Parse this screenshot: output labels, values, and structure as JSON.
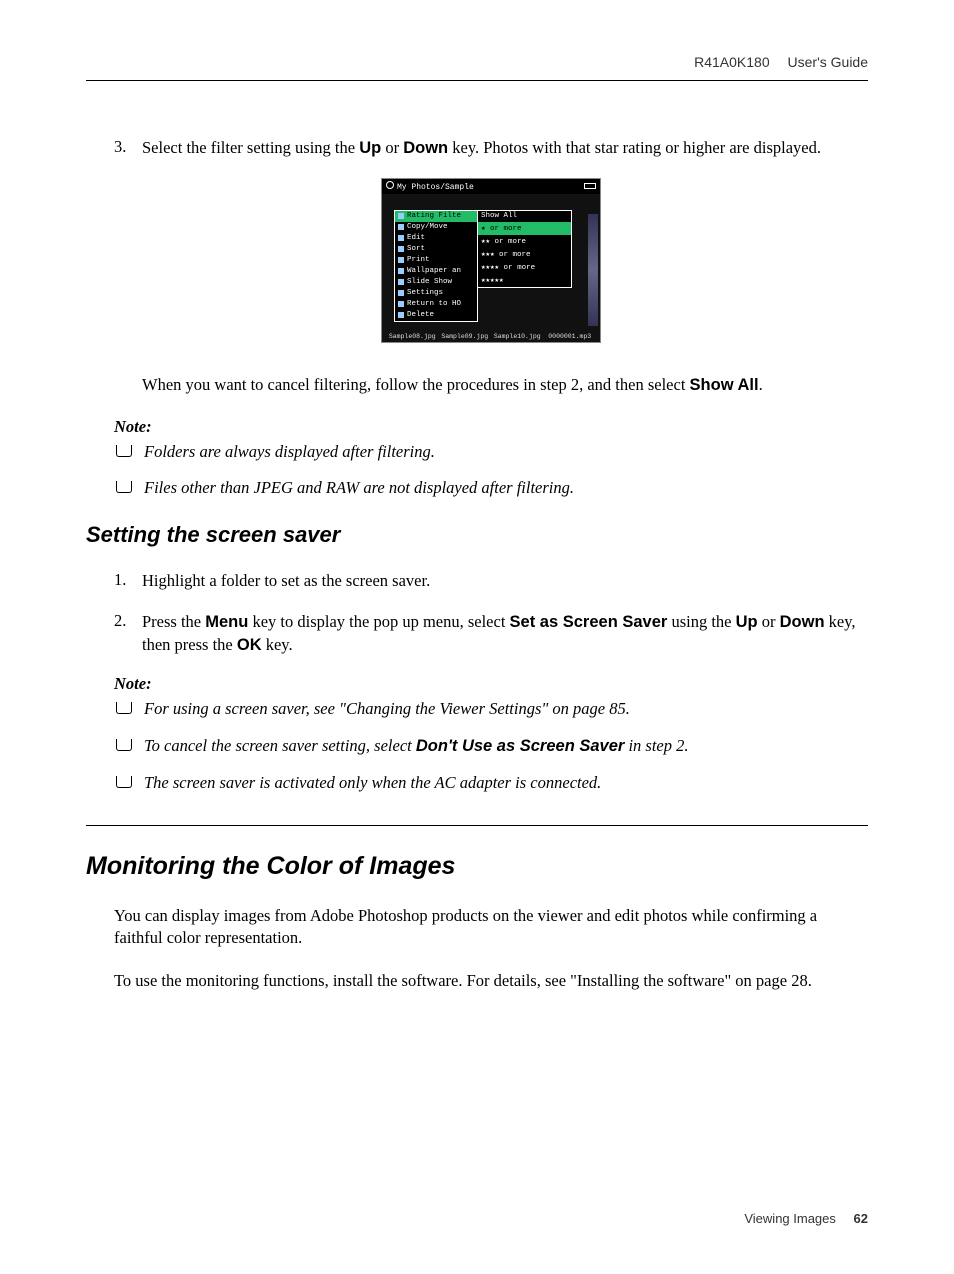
{
  "header": {
    "model": "R41A0K180",
    "doc": "User's Guide"
  },
  "step3": {
    "num": "3.",
    "text_pre": "Select the filter setting using the ",
    "key_up": "Up",
    "text_mid1": " or ",
    "key_down": "Down",
    "text_post": " key. Photos with that star rating or higher are displayed."
  },
  "screenshot": {
    "title": "My Photos/Sample",
    "left_menu": [
      "Rating Filte",
      "Copy/Move",
      "Edit",
      "Sort",
      "Print",
      "Wallpaper an",
      "Slide Show",
      "Settings",
      "Return to HO",
      "Delete"
    ],
    "left_highlight_index": 0,
    "right_menu": [
      "Show All",
      "★ or more",
      "★★ or more",
      "★★★ or more",
      "★★★★ or more",
      "★★★★★"
    ],
    "right_highlight_index": 1,
    "thumbnails": [
      "Sample08.jpg",
      "Sample09.jpg",
      "Sample10.jpg",
      "0000001.mp3"
    ]
  },
  "cancel_para": {
    "pre": "When you want to cancel filtering, follow the procedures in step 2, and then select ",
    "bold": "Show All",
    "post": "."
  },
  "note1": {
    "heading": "Note:",
    "items": [
      "Folders are always displayed after filtering.",
      "Files other than JPEG and RAW are not displayed after filtering."
    ]
  },
  "h2_screensaver": "Setting the screen saver",
  "ss_step1": {
    "num": "1.",
    "text": "Highlight a folder to set as the screen saver."
  },
  "ss_step2": {
    "num": "2.",
    "p1": "Press the ",
    "b1": "Menu",
    "p2": " key to display the pop up menu, select ",
    "b2": "Set as Screen Saver",
    "p3": " using the ",
    "b3": "Up",
    "p4": " or ",
    "b4": "Down",
    "p5": " key, then press the ",
    "b5": "OK",
    "p6": " key."
  },
  "note2": {
    "heading": "Note:",
    "item1": "For using a screen saver, see \"Changing the Viewer Settings\" on page 85.",
    "item2_pre": "To cancel the screen saver setting, select ",
    "item2_bold": "Don't Use as Screen Saver",
    "item2_post": " in step 2.",
    "item3": "The screen saver is activated only when the AC adapter is connected."
  },
  "h1_monitor": "Monitoring the Color of Images",
  "monitor_p1": "You can display images from Adobe Photoshop products on the viewer and edit photos while confirming a faithful color representation.",
  "monitor_p2": "To use the monitoring functions, install the software. For details, see \"Installing the software\" on page 28.",
  "footer": {
    "section": "Viewing Images",
    "page": "62"
  }
}
